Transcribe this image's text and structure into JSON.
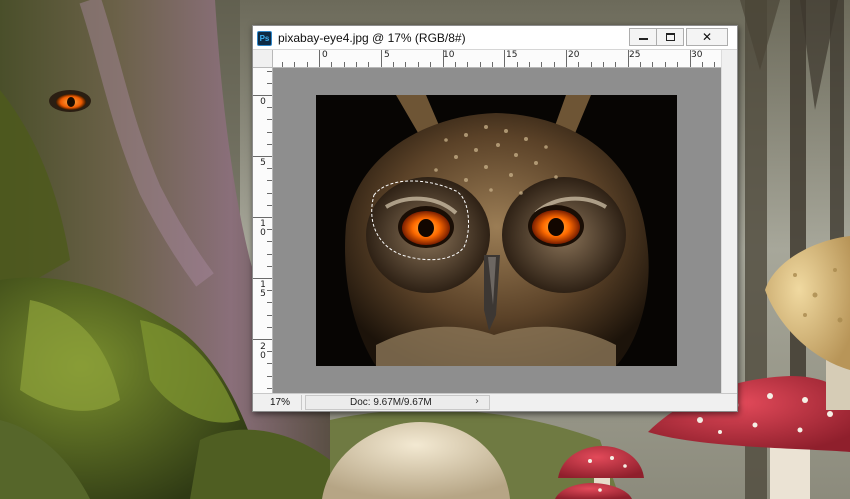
{
  "window": {
    "title": "pixabay-eye4.jpg @ 17% (RGB/8#)",
    "app_icon_label": "Ps"
  },
  "window_controls": {
    "minimize_icon": "minimize-icon",
    "maximize_icon": "maximize-icon",
    "close_glyph": "✕"
  },
  "rulers": {
    "horizontal_labels": [
      "0",
      "5",
      "10",
      "15",
      "20",
      "25",
      "30"
    ],
    "vertical_labels": [
      "0",
      "5",
      "1\n0",
      "1\n5",
      "2\n0"
    ]
  },
  "status_bar": {
    "zoom": "17%",
    "doc_size": "Doc: 9.67M/9.67M",
    "menu_arrow": "›"
  },
  "colors": {
    "owl_eye": "#ff6a00",
    "canvas_bg": "#8e8e8e",
    "ps_icon_bg": "#0d2a44",
    "ps_icon_text": "#3fb1f2"
  }
}
